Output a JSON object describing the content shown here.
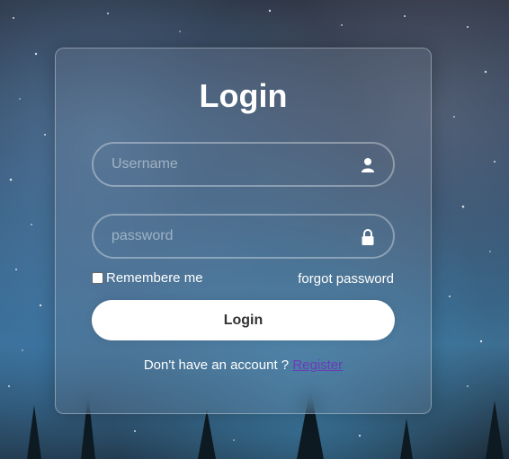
{
  "background": {
    "name": "starry-night-forest"
  },
  "form": {
    "title": "Login",
    "username": {
      "placeholder": "Username",
      "value": "",
      "icon": "user-icon"
    },
    "password": {
      "placeholder": "password",
      "value": "",
      "icon": "lock-icon"
    },
    "remember_label": "Remembere me",
    "remember_checked": false,
    "forgot_label": "forgot password",
    "submit_label": "Login",
    "register_prompt": "Don't have an account ?",
    "register_label": "Register"
  },
  "colors": {
    "card_border": "#ffffff",
    "button_bg": "#ffffff",
    "button_text": "#333333",
    "link": "#6a3bb8",
    "text": "#ffffff"
  }
}
